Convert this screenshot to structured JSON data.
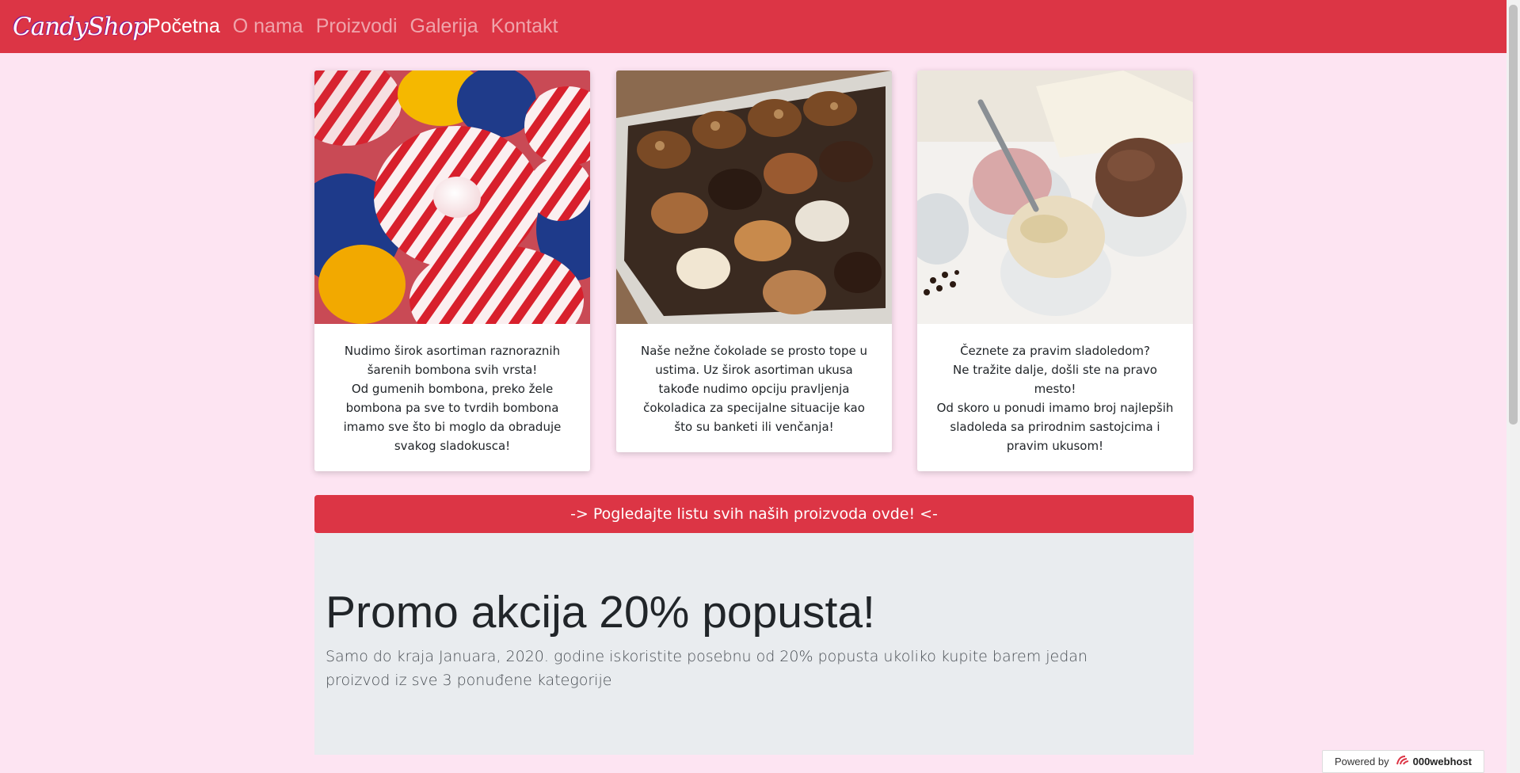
{
  "navbar": {
    "brand": "CandyShop",
    "links": [
      {
        "label": "Početna",
        "active": true
      },
      {
        "label": "O nama",
        "active": false
      },
      {
        "label": "Proizvodi",
        "active": false
      },
      {
        "label": "Galerija",
        "active": false
      },
      {
        "label": "Kontakt",
        "active": false
      }
    ]
  },
  "cards": [
    {
      "image": "peppermint-candies-photo",
      "lines": [
        "Nudimo širok asortiman raznoraznih šarenih bombona svih vrsta!",
        "Od gumenih bombona, preko žele bombona pa sve to tvrdih bombona imamo sve što bi moglo da obraduje svakog sladokusca!"
      ]
    },
    {
      "image": "chocolate-box-photo",
      "lines": [
        "Naše nežne čokolade se prosto tope u ustima. Uz širok asortiman ukusa takođe nudimo opciju pravljenja čokoladica za specijalne situacije kao što su banketi ili venčanja!"
      ]
    },
    {
      "image": "ice-cream-bowls-photo",
      "lines": [
        "Čeznete za pravim sladoledom?",
        "Ne tražite dalje, došli ste na pravo mesto!",
        "Od skoro u ponudi imamo broj najlepših sladoleda sa prirodnim sastojcima i pravim ukusom!"
      ]
    }
  ],
  "cta_button": "-> Pogledajte listu svih naših proizvoda ovde! <-",
  "promo": {
    "title": "Promo akcija 20% popusta!",
    "text": "Samo do kraja Januara, 2020. godine iskoristite posebnu od 20% popusta ukoliko kupite barem jedan proizvod iz sve 3 ponuđene kategorije"
  },
  "powered_by": {
    "label": "Powered by",
    "brand": "000webhost"
  },
  "colors": {
    "navbar": "#dc3545",
    "page_bg": "#fde4f2",
    "jumbotron_bg": "#e9ecef"
  }
}
